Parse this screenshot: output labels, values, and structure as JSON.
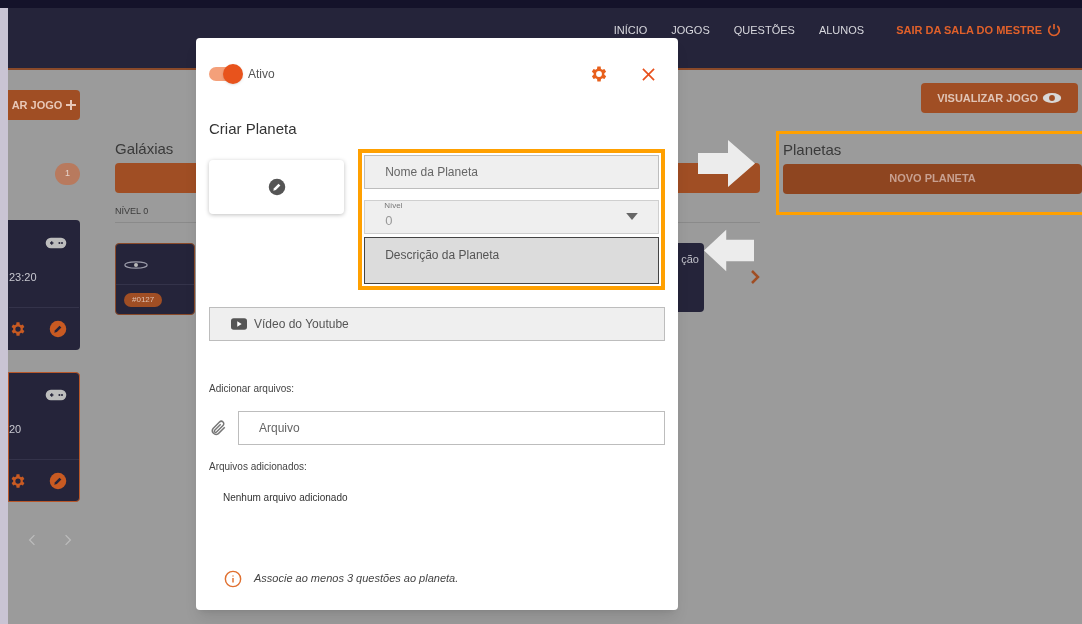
{
  "header": {
    "nav": [
      {
        "label": "INÍCIO"
      },
      {
        "label": "JOGOS"
      },
      {
        "label": "QUESTÕES"
      },
      {
        "label": "ALUNOS"
      }
    ],
    "exit_link": "SAIR DA SALA DO MESTRE"
  },
  "left_panel": {
    "button": "AR JOGO",
    "badge": "1",
    "cards": [
      {
        "time": "23:20",
        "selected": false
      },
      {
        "time": "20",
        "selected": true
      }
    ]
  },
  "galaxies": {
    "title": "Galáxias",
    "level_label": "NÍVEL 0",
    "card_tag": "#0127",
    "card_title": "ção"
  },
  "planets": {
    "view_button": "VISUALIZAR JOGO",
    "title": "Planetas",
    "button": "NOVO PLANETA"
  },
  "modal": {
    "toggle": {
      "label": "Ativo",
      "on": true
    },
    "title": "Criar Planeta",
    "fields": [
      {
        "kind": "input",
        "placeholder": "Nome da Planeta"
      },
      {
        "kind": "select",
        "label": "Nível",
        "value": "0"
      },
      {
        "kind": "textarea",
        "placeholder": "Descrição da Planeta"
      }
    ],
    "video": {
      "placeholder": "Vídeo do Youtube"
    },
    "files_label": "Adicionar arquivos:",
    "file_input": {
      "placeholder": "Arquivo"
    },
    "added_label": "Arquivos adicionados:",
    "empty_text": "Nenhum arquivo adicionado",
    "notice": "Associe ao menos 3 questões ao planeta."
  }
}
